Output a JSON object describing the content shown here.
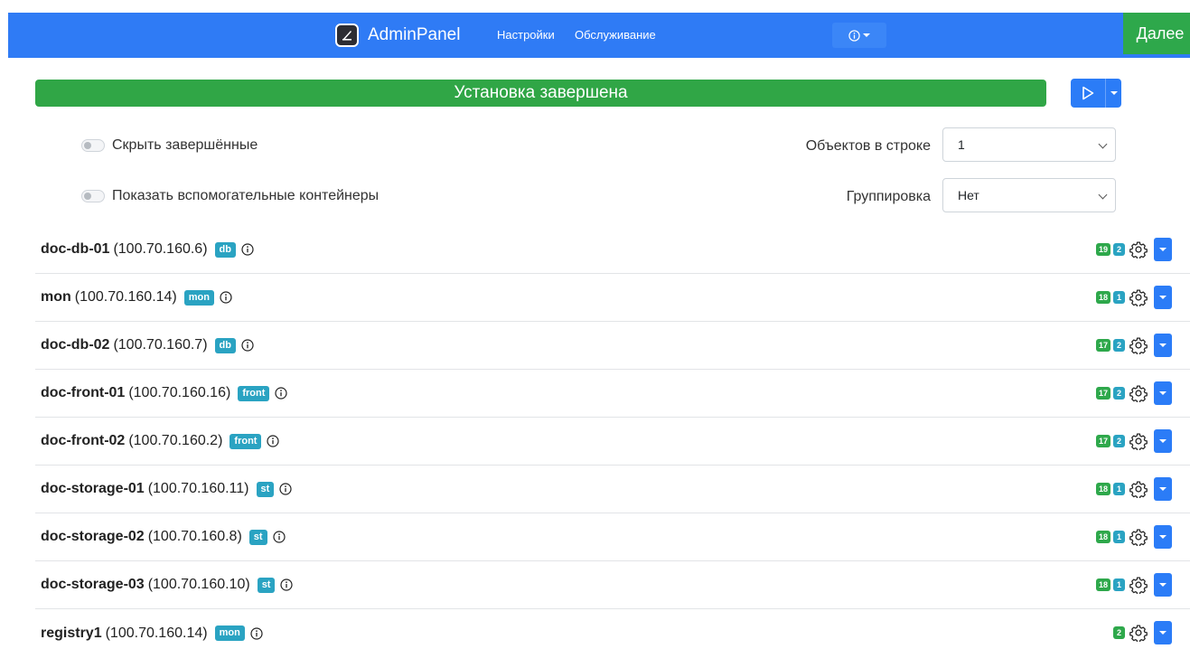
{
  "navbar": {
    "brand": "AdminPanel",
    "links": [
      "Настройки",
      "Обслуживание"
    ],
    "info_icon": "info-icon",
    "next_label": "Далее"
  },
  "status": {
    "label": "Установка завершена",
    "action_icon": "play-icon"
  },
  "toggles": {
    "hide_completed": "Скрыть завершённые",
    "show_helpers": "Показать вспомогательные контейнеры"
  },
  "selects": {
    "per_row_label": "Объектов в строке",
    "per_row_value": "1",
    "grouping_label": "Группировка",
    "grouping_value": "Нет"
  },
  "hosts": [
    {
      "name": "doc-db-01",
      "ip": "(100.70.160.6)",
      "tag": "db",
      "count_a": "19",
      "count_b": "2"
    },
    {
      "name": "mon",
      "ip": "(100.70.160.14)",
      "tag": "mon",
      "count_a": "18",
      "count_b": "1"
    },
    {
      "name": "doc-db-02",
      "ip": "(100.70.160.7)",
      "tag": "db",
      "count_a": "17",
      "count_b": "2"
    },
    {
      "name": "doc-front-01",
      "ip": "(100.70.160.16)",
      "tag": "front",
      "count_a": "17",
      "count_b": "2"
    },
    {
      "name": "doc-front-02",
      "ip": "(100.70.160.2)",
      "tag": "front",
      "count_a": "17",
      "count_b": "2"
    },
    {
      "name": "doc-storage-01",
      "ip": "(100.70.160.11)",
      "tag": "st",
      "count_a": "18",
      "count_b": "1"
    },
    {
      "name": "doc-storage-02",
      "ip": "(100.70.160.8)",
      "tag": "st",
      "count_a": "18",
      "count_b": "1"
    },
    {
      "name": "doc-storage-03",
      "ip": "(100.70.160.10)",
      "tag": "st",
      "count_a": "18",
      "count_b": "1"
    },
    {
      "name": "registry1",
      "ip": "(100.70.160.14)",
      "tag": "mon",
      "count_a": "2",
      "count_b": ""
    }
  ],
  "colors": {
    "navbar": "#2f7bf5",
    "success": "#30a646",
    "primary": "#2b7cf7",
    "tag": "#2aa3c2"
  }
}
